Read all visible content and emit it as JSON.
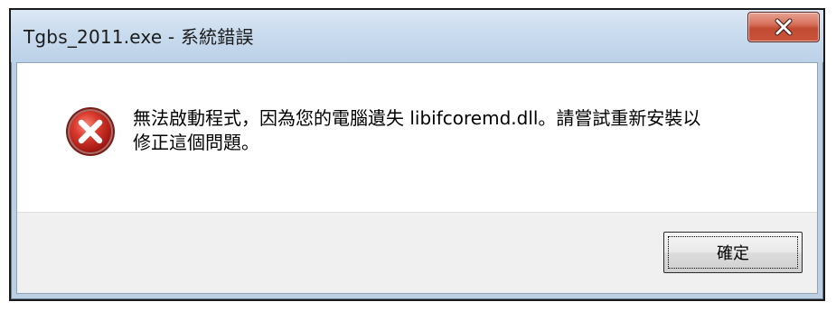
{
  "dialog": {
    "title": "Tgbs_2011.exe - 系統錯誤",
    "close_label": "X",
    "icon": "error-icon",
    "message": "無法啟動程式，因為您的電腦遺失 libifcoremd.dll。請嘗試重新安裝以\n修正這個問題。",
    "ok_label": "確定"
  },
  "colors": {
    "titlebar": "#c9dbee",
    "close_button": "#c9553c",
    "error_red": "#d8362a",
    "footer": "#f0f0f0"
  }
}
